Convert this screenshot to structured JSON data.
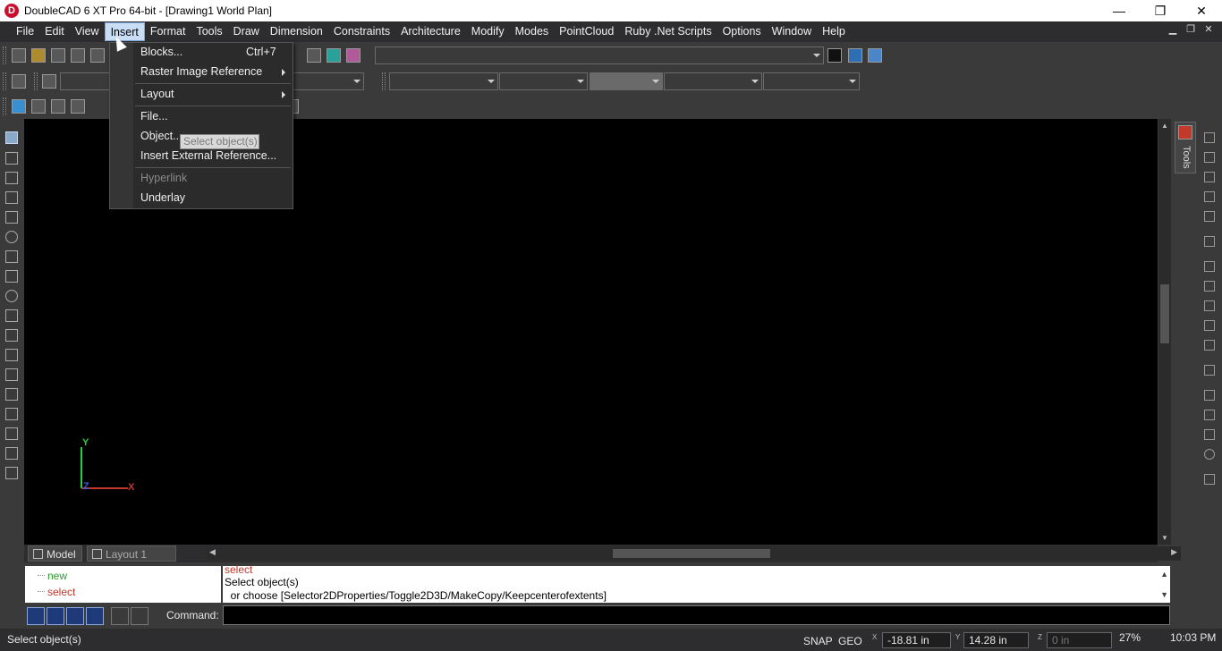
{
  "window": {
    "title": "DoubleCAD 6 XT Pro 64-bit - [Drawing1 World Plan]",
    "logo_letter": "D",
    "minimize": "—",
    "restore": "❐",
    "close": "✕"
  },
  "menubar": {
    "items": [
      "File",
      "Edit",
      "View",
      "Insert",
      "Format",
      "Tools",
      "Draw",
      "Dimension",
      "Constraints",
      "Architecture",
      "Modify",
      "Modes",
      "PointCloud",
      "Ruby .Net Scripts",
      "Options",
      "Window",
      "Help"
    ],
    "active": "Insert",
    "mdi_min": "▁",
    "mdi_restore": "❐",
    "mdi_close": "✕"
  },
  "insert_menu": {
    "blocks": "Blocks...",
    "blocks_shortcut": "Ctrl+7",
    "raster": "Raster Image Reference",
    "layout": "Layout",
    "file": "File...",
    "object": "Object...",
    "xref": "Insert External Reference...",
    "hyperlink": "Hyperlink",
    "underlay": "Underlay"
  },
  "tooltip": "Select object(s)",
  "canvas": {
    "axis_y": "Y",
    "axis_x": "X",
    "axis_z": "Z",
    "colors": {
      "y_axis": "#2ecc40",
      "x_axis": "#c0392b",
      "z_axis": "#3b5bdb"
    }
  },
  "tools_tab": "Tools",
  "layout_tabs": [
    "Model",
    "Layout 1"
  ],
  "command": {
    "tree": [
      "new",
      "select"
    ],
    "history": [
      "select",
      "Select object(s)",
      "  or choose [Selector2DProperties/Toggle2D3D/MakeCopy/Keepcenterofextents]"
    ],
    "label": "Command:",
    "input_value": ""
  },
  "status": {
    "message": "Select object(s)",
    "snap": "SNAP",
    "geo": "GEO",
    "x_tag": "X",
    "y_tag": "Y",
    "z_tag": "Z",
    "x_value": "-18.81 in",
    "y_value": "14.28 in",
    "z_value": "0 in",
    "zoom": "27%",
    "time": "10:03 PM"
  }
}
